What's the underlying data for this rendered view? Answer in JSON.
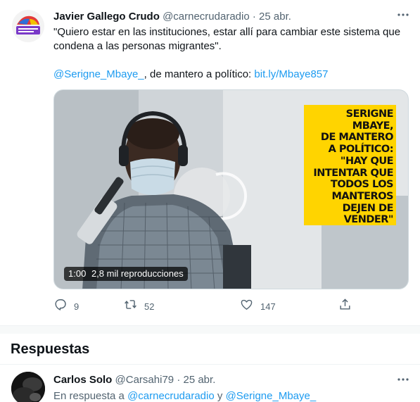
{
  "tweet": {
    "author_name": "Javier Gallego Crudo",
    "author_handle": "@carnecrudaradio",
    "separator": "·",
    "date": "25 abr.",
    "text_line1": "\"Quiero estar en las instituciones, estar allí para cambiar este sistema que condena a las personas migrantes\".",
    "mention": "@Serigne_Mbaye_",
    "text_mid": ", de mantero a político: ",
    "url": "bit.ly/Mbaye857",
    "video": {
      "duration": "1:00",
      "views": "2,8 mil reproducciones",
      "overlay_lines": [
        "SERIGNE MBAYE,",
        "DE MANTERO",
        "A POLÍTICO:",
        "\"HAY QUE",
        "INTENTAR QUE",
        "TODOS LOS",
        "MANTEROS",
        "DEJEN DE",
        "VENDER\""
      ]
    },
    "actions": {
      "replies": "9",
      "retweets": "52",
      "likes": "147"
    }
  },
  "replies_section": {
    "title": "Respuestas"
  },
  "reply": {
    "author_name": "Carlos Solo",
    "author_handle": "@Carsahi79",
    "separator": "·",
    "date": "25 abr.",
    "context_prefix": "En respuesta a ",
    "context_mention1": "@carnecrudaradio",
    "context_and": " y ",
    "context_mention2": "@Serigne_Mbaye_"
  },
  "icons": {
    "more": "more-horizontal-icon",
    "reply": "reply-bubble-icon",
    "retweet": "retweet-icon",
    "like": "heart-icon",
    "share": "share-icon"
  },
  "colors": {
    "link": "#1d9bf0",
    "secondary_text": "#536471",
    "overlay_yellow": "#ffd400"
  }
}
